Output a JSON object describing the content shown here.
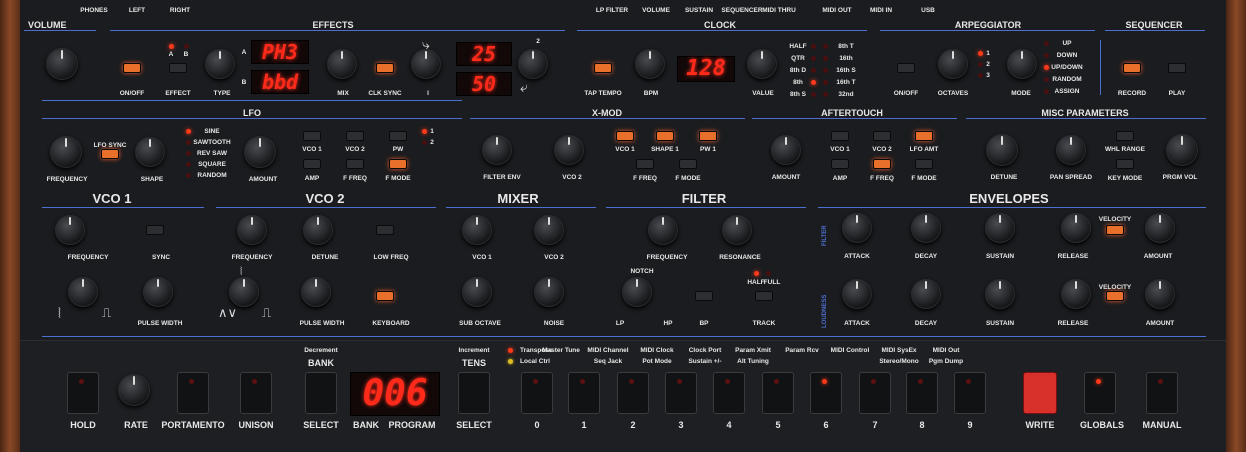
{
  "jacks": [
    "PHONES",
    "LEFT",
    "RIGHT"
  ],
  "rear": [
    "LP FILTER",
    "VOLUME",
    "SUSTAIN",
    "SEQUENCER",
    "MIDI THRU",
    "MIDI OUT",
    "MIDI IN",
    "USB"
  ],
  "sections": {
    "volume": "VOLUME",
    "effects": "EFFECTS",
    "clock": "CLOCK",
    "arp": "ARPEGGIATOR",
    "seq": "SEQUENCER",
    "lfo": "LFO",
    "xmod": "X-MOD",
    "aftertouch": "AFTERTOUCH",
    "misc": "MISC PARAMETERS",
    "vco1": "VCO 1",
    "vco2": "VCO 2",
    "mixer": "MIXER",
    "filter": "FILTER",
    "env": "ENVELOPES"
  },
  "effects": {
    "onoff": "ON/OFF",
    "effect": "EFFECT",
    "type": "TYPE",
    "mix": "MIX",
    "clksync": "CLK SYNC",
    "i": "I",
    "ab_a": "A",
    "ab_b": "B",
    "disp_a": "PH3",
    "disp_b": "bbd",
    "disp_c": "25",
    "disp_d": "50",
    "two": "2",
    "a": "A",
    "b": "B"
  },
  "clock": {
    "tap": "TAP TEMPO",
    "bpm": "BPM",
    "display": "128",
    "value": "VALUE",
    "left": [
      "HALF",
      "QTR",
      "8th D",
      "8th",
      "8th S"
    ],
    "right": [
      "8th T",
      "16th",
      "16th S",
      "16th T",
      "32nd"
    ]
  },
  "arp": {
    "onoff": "ON/OFF",
    "octaves": "OCTAVES",
    "mode": "MODE",
    "oct_leds": [
      "1",
      "2",
      "3"
    ],
    "modes": [
      "UP",
      "DOWN",
      "UP/DOWN",
      "RANDOM",
      "ASSIGN"
    ]
  },
  "seq": {
    "record": "RECORD",
    "play": "PLAY"
  },
  "lfo": {
    "frequency": "FREQUENCY",
    "lfosync": "LFO SYNC",
    "shape": "SHAPE",
    "amount": "AMOUNT",
    "shapes": [
      "SINE",
      "SAWTOOTH",
      "REV SAW",
      "SQUARE",
      "RANDOM"
    ],
    "vco1": "VCO 1",
    "vco2": "VCO 2",
    "pw": "PW",
    "amp": "AMP",
    "ffreq": "F FREQ",
    "fmode": "F MODE",
    "l1": "1",
    "l2": "2"
  },
  "xmod": {
    "filterenv": "FILTER ENV",
    "vco2": "VCO 2",
    "vco1": "VCO 1",
    "shape1": "SHAPE 1",
    "pw1": "PW 1",
    "ffreq": "F FREQ",
    "fmode": "F MODE"
  },
  "at": {
    "amount": "AMOUNT",
    "vco1": "VCO 1",
    "vco2": "VCO 2",
    "lfoamt": "LFO AMT",
    "amp": "AMP",
    "ffreq": "F FREQ",
    "fmode": "F MODE"
  },
  "misc": {
    "detune": "DETUNE",
    "panspread": "PAN SPREAD",
    "whlrange": "WHL RANGE",
    "keymode": "KEY MODE",
    "prgmvol": "PRGM VOL"
  },
  "vco1": {
    "frequency": "FREQUENCY",
    "sync": "SYNC",
    "pulsewidth": "PULSE WIDTH"
  },
  "vco2": {
    "frequency": "FREQUENCY",
    "detune": "DETUNE",
    "lowfreq": "LOW FREQ",
    "pulsewidth": "PULSE WIDTH",
    "keyboard": "KEYBOARD"
  },
  "mixer": {
    "vco1": "VCO 1",
    "vco2": "VCO 2",
    "suboctave": "SUB OCTAVE",
    "noise": "NOISE"
  },
  "filter": {
    "frequency": "FREQUENCY",
    "resonance": "RESONANCE",
    "notch": "NOTCH",
    "lp": "LP",
    "hp": "HP",
    "bp": "BP",
    "half": "HALF",
    "full": "FULL",
    "track": "TRACK"
  },
  "env": {
    "filter": "FILTER",
    "loudness": "LOUDNESS",
    "attack": "ATTACK",
    "decay": "DECAY",
    "sustain": "SUSTAIN",
    "release": "RELEASE",
    "velocity": "VELOCITY",
    "amount": "AMOUNT"
  },
  "bottom": {
    "hold": "HOLD",
    "rate": "RATE",
    "portamento": "PORTAMENTO",
    "unison": "UNISON",
    "decrement": "Decrement",
    "bank": "BANK",
    "select": "SELECT",
    "display": "006",
    "banklabel": "BANK",
    "program": "PROGRAM",
    "increment": "Increment",
    "tens": "TENS",
    "select2": "SELECT",
    "write": "WRITE",
    "globals": "GLOBALS",
    "manual": "MANUAL",
    "transpose": "Transpose",
    "localctrl": "Local Ctrl"
  },
  "numkeys": [
    {
      "num": "0",
      "top": "Master Tune",
      "bot": ""
    },
    {
      "num": "1",
      "top": "MIDI Channel",
      "bot": "Seq Jack"
    },
    {
      "num": "2",
      "top": "MIDI Clock",
      "bot": "Pot Mode"
    },
    {
      "num": "3",
      "top": "Clock Port",
      "bot": "Sustain +/-"
    },
    {
      "num": "4",
      "top": "Param Xmit",
      "bot": "Alt Tuning"
    },
    {
      "num": "5",
      "top": "Param Rcv",
      "bot": ""
    },
    {
      "num": "6",
      "top": "MIDI Control",
      "bot": ""
    },
    {
      "num": "7",
      "top": "MIDI SysEx",
      "bot": "Stereo/Mono"
    },
    {
      "num": "8",
      "top": "MIDI Out",
      "bot": "Pgm Dump"
    },
    {
      "num": "9",
      "top": "",
      "bot": ""
    }
  ],
  "icons": [
    "curved-arrow-icon",
    "saw-wave-icon",
    "square-wave-icon",
    "triangle-wave-icon"
  ],
  "colors": {
    "panel": "#1b1c1f",
    "accent": "#4d6fcf",
    "led": "#ff3a1a",
    "write": "#d8302a"
  }
}
